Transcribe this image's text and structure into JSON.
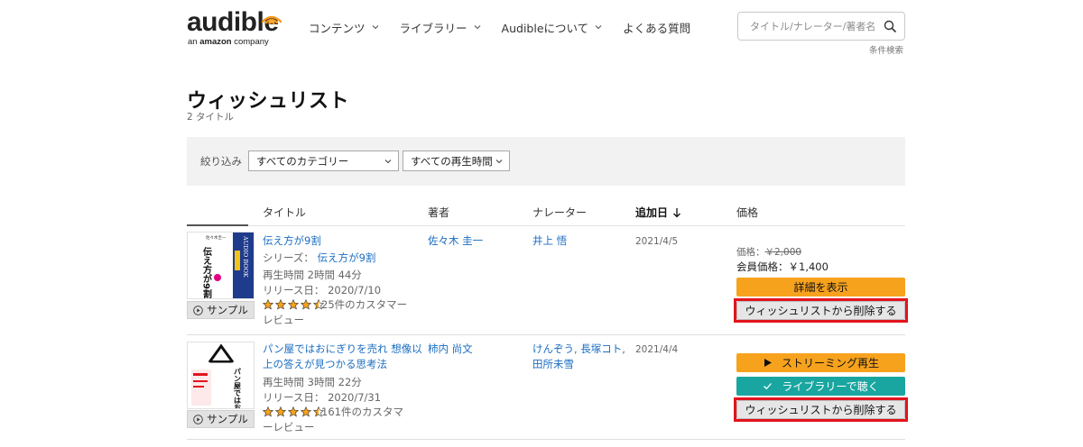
{
  "header": {
    "logo_word": "audible",
    "logo_sub_prefix": "an ",
    "logo_sub_brand": "amazon",
    "logo_sub_suffix": " company",
    "nav": [
      {
        "label": "コンテンツ",
        "chevron": true
      },
      {
        "label": "ライブラリー",
        "chevron": true
      },
      {
        "label": "Audibleについて",
        "chevron": true
      },
      {
        "label": "よくある質問",
        "chevron": false
      }
    ],
    "search_placeholder": "タイトル/ナレーター/著者名で",
    "advanced_search": "条件検索"
  },
  "page": {
    "title": "ウィッシュリスト",
    "count": "2 タイトル"
  },
  "filter": {
    "label": "絞り込み",
    "category": "すべてのカテゴリー",
    "duration": "すべての再生時間"
  },
  "columns": {
    "title": "タイトル",
    "author": "著者",
    "narrator": "ナレーター",
    "added": "追加日",
    "price": "価格"
  },
  "items": [
    {
      "title": "伝え方が9割",
      "series_label": "シリーズ：",
      "series": "伝え方が9割",
      "length": "再生時間 2時間 44分",
      "release": "リリース日： 2020/7/10",
      "rating": 4.5,
      "reviews_line1": "25件のカスタマー",
      "reviews_line2": "レビュー",
      "author": "佐々木 圭一",
      "narrator": "井上 悟",
      "added": "2021/4/5",
      "price_label": "価格：",
      "price_old": "￥2,000",
      "member_price": "会員価格：￥1,400",
      "sample": "サンプル",
      "cover_text_main": "伝え方が9割",
      "cover_text_side": "AUDIO BOOK",
      "cover_author": "佐々木圭一",
      "btn_primary": "詳細を表示",
      "btn_remove": "ウィッシュリストから削除する"
    },
    {
      "title_line1": "パン屋ではおにぎりを売れ 想像以",
      "title_line2": "上の答えが見つかる思考法",
      "length": "再生時間 3時間 22分",
      "release": "リリース日： 2020/7/31",
      "rating": 4.5,
      "reviews_line1": "161件のカスタマ",
      "reviews_line2": "ーレビュー",
      "author": "柿内 尚文",
      "narrator_line1": "けんぞう, 長塚コト,",
      "narrator_line2": "田所未雪",
      "added": "2021/4/4",
      "sample": "サンプル",
      "cover_text_main": "パン屋ではおにぎりを売れ",
      "btn_stream": "ストリーミング再生",
      "btn_library": "ライブラリーで聴く",
      "btn_remove": "ウィッシュリストから削除する"
    }
  ],
  "colors": {
    "link": "#1b6ec2",
    "orange": "#f7a21d",
    "teal": "#1aa6a0",
    "highlight": "#e1141e",
    "logo_orange": "#f7991c"
  }
}
